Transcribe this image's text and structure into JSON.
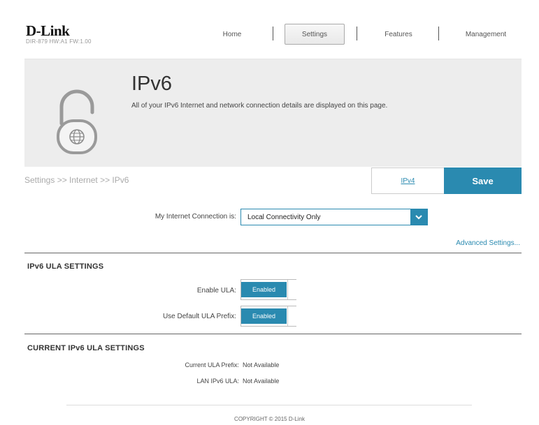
{
  "header": {
    "logo": "D-Link",
    "model": "DIR-879 HW:A1 FW:1.00",
    "nav": [
      {
        "label": "Home"
      },
      {
        "label": "Settings"
      },
      {
        "label": "Features"
      },
      {
        "label": "Management"
      }
    ]
  },
  "banner": {
    "title": "IPv6",
    "description": "All of your IPv6 Internet and network connection details are displayed on this page.",
    "icon": "lock-globe-icon"
  },
  "breadcrumb": "Settings >> Internet >> IPv6",
  "actions": {
    "ipv4_tab": "IPv4",
    "save": "Save"
  },
  "connection": {
    "label": "My Internet Connection is:",
    "value": "Local Connectivity Only"
  },
  "advanced_link": "Advanced Settings...",
  "ula_settings": {
    "title": "IPv6 ULA SETTINGS",
    "fields": [
      {
        "label": "Enable ULA:",
        "value": "Enabled"
      },
      {
        "label": "Use Default ULA Prefix:",
        "value": "Enabled"
      }
    ]
  },
  "current_ula": {
    "title": "CURRENT IPv6 ULA SETTINGS",
    "rows": [
      {
        "label": "Current ULA Prefix:",
        "value": "Not Available"
      },
      {
        "label": "LAN IPv6 ULA:",
        "value": "Not Available"
      }
    ]
  },
  "footer": {
    "copyright": "COPYRIGHT © 2015 D-Link"
  },
  "colors": {
    "accent": "#2a8ab0",
    "banner": "#ededed"
  }
}
